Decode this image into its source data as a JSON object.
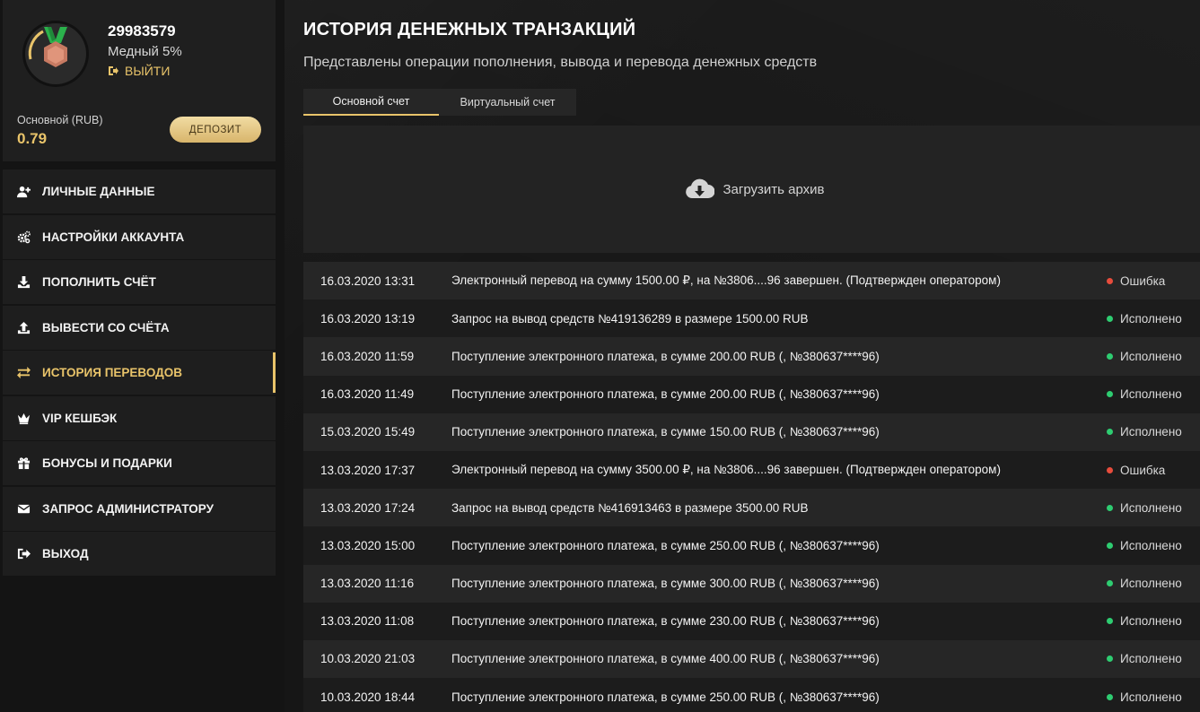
{
  "profile": {
    "user_id": "29983579",
    "level": "Медный 5%",
    "logout_label": "ВЫЙТИ",
    "balance_label": "Основной (RUB)",
    "balance_value": "0.79",
    "deposit_label": "ДЕПОЗИТ"
  },
  "menu": [
    {
      "label": "ЛИЧНЫЕ ДАННЫЕ",
      "icon": "user-plus-icon"
    },
    {
      "label": "НАСТРОЙКИ АККАУНТА",
      "icon": "gears-icon"
    },
    {
      "label": "ПОПОЛНИТЬ СЧЁТ",
      "icon": "download-icon"
    },
    {
      "label": "ВЫВЕСТИ СО СЧЁТА",
      "icon": "upload-icon"
    },
    {
      "label": "ИСТОРИЯ ПЕРЕВОДОВ",
      "icon": "exchange-icon",
      "active": true
    },
    {
      "label": "VIP КЕШБЭК",
      "icon": "crown-icon"
    },
    {
      "label": "БОНУСЫ И ПОДАРКИ",
      "icon": "gift-icon"
    },
    {
      "label": "ЗАПРОС АДМИНИСТРАТОРУ",
      "icon": "envelope-icon"
    },
    {
      "label": "ВЫХОД",
      "icon": "sign-out-icon"
    }
  ],
  "page": {
    "title": "ИСТОРИЯ ДЕНЕЖНЫХ ТРАНЗАКЦИЙ",
    "subtitle": "Представлены операции пополнения, вывода и перевода денежных средств"
  },
  "tabs": {
    "main_account": "Основной счет",
    "virtual_account": "Виртуальный счет"
  },
  "archive": {
    "label": "Загрузить архив"
  },
  "colors": {
    "accent": "#e9c46a",
    "success": "#2ecc71",
    "error": "#e74c3c"
  },
  "transactions": [
    {
      "date": "16.03.2020 13:31",
      "desc": "Электронный перевод на сумму 1500.00 ₽, на №3806....96 завершен. (Подтвержден оператором)",
      "status": "Ошибка",
      "ok": false
    },
    {
      "date": "16.03.2020 13:19",
      "desc": "Запрос на вывод средств №419136289 в размере 1500.00 RUB",
      "status": "Исполнено",
      "ok": true
    },
    {
      "date": "16.03.2020 11:59",
      "desc": "Поступление электронного платежа, в сумме 200.00 RUB (, №380637****96)",
      "status": "Исполнено",
      "ok": true
    },
    {
      "date": "16.03.2020 11:49",
      "desc": "Поступление электронного платежа, в сумме 200.00 RUB (, №380637****96)",
      "status": "Исполнено",
      "ok": true
    },
    {
      "date": "15.03.2020 15:49",
      "desc": "Поступление электронного платежа, в сумме 150.00 RUB (, №380637****96)",
      "status": "Исполнено",
      "ok": true
    },
    {
      "date": "13.03.2020 17:37",
      "desc": "Электронный перевод на сумму 3500.00 ₽, на №3806....96 завершен. (Подтвержден оператором)",
      "status": "Ошибка",
      "ok": false
    },
    {
      "date": "13.03.2020 17:24",
      "desc": "Запрос на вывод средств №416913463 в размере 3500.00 RUB",
      "status": "Исполнено",
      "ok": true
    },
    {
      "date": "13.03.2020 15:00",
      "desc": "Поступление электронного платежа, в сумме 250.00 RUB (, №380637****96)",
      "status": "Исполнено",
      "ok": true
    },
    {
      "date": "13.03.2020 11:16",
      "desc": "Поступление электронного платежа, в сумме 300.00 RUB (, №380637****96)",
      "status": "Исполнено",
      "ok": true
    },
    {
      "date": "13.03.2020 11:08",
      "desc": "Поступление электронного платежа, в сумме 230.00 RUB (, №380637****96)",
      "status": "Исполнено",
      "ok": true
    },
    {
      "date": "10.03.2020 21:03",
      "desc": "Поступление электронного платежа, в сумме 400.00 RUB (, №380637****96)",
      "status": "Исполнено",
      "ok": true
    },
    {
      "date": "10.03.2020 18:44",
      "desc": "Поступление электронного платежа, в сумме 250.00 RUB (, №380637****96)",
      "status": "Исполнено",
      "ok": true
    }
  ]
}
